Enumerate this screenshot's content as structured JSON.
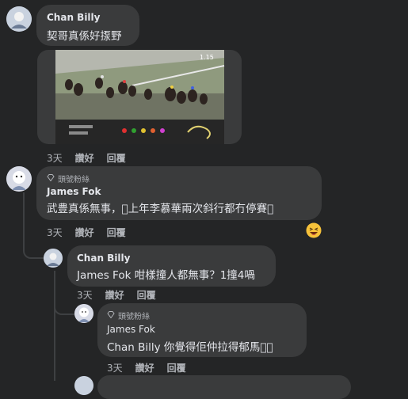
{
  "comments": [
    {
      "author": "Chan Billy",
      "text": "契哥真係好揼野",
      "time": "3天",
      "like_label": "讚好",
      "reply_label": "回覆"
    },
    {
      "badge": "頭號粉絲",
      "author": "James Fok",
      "text": "武豊真係無事，󾌵上年李慕華兩次斜行都冇停賽󾌵",
      "time": "3天",
      "like_label": "讚好",
      "reply_label": "回覆",
      "reaction": "laughing-emoji"
    },
    {
      "author": "Chan Billy",
      "text": "James Fok 咁樣撞人都無事？1撞4喎",
      "time": "3天",
      "like_label": "讚好",
      "reply_label": "回覆"
    },
    {
      "badge": "頭號粉絲",
      "author": "James Fok",
      "text": "Chan Billy 你覺得佢仲拉得郁馬󾌵？",
      "time": "3天",
      "like_label": "讚好",
      "reply_label": "回覆"
    }
  ],
  "video_overlay_time": "1.15",
  "colors": {
    "background": "#242526",
    "bubble": "#3a3b3c",
    "text": "#e4e6eb",
    "secondary": "#b0b3b8"
  }
}
